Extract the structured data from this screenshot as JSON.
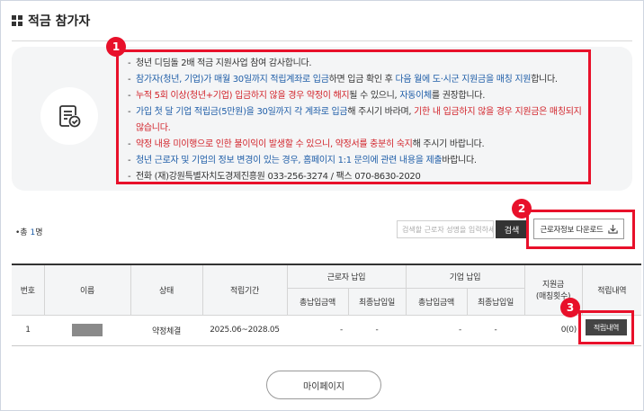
{
  "page": {
    "title": "적금 참가자"
  },
  "notice": {
    "lines": [
      {
        "parts": [
          {
            "t": "청년 디딤돌 2배 적금 지원사업 참여 감사합니다.",
            "c": ""
          }
        ]
      },
      {
        "parts": [
          {
            "t": "참가자(청년, 기업)가 매월 30일까지 적립계좌로 입금",
            "c": "blue"
          },
          {
            "t": "하면 입금 확인 후 ",
            "c": ""
          },
          {
            "t": "다음 월에 도·시군 지원금을 매칭 지원",
            "c": "blue"
          },
          {
            "t": "합니다.",
            "c": ""
          }
        ]
      },
      {
        "parts": [
          {
            "t": "누적 5회 이상(청년+기업) 입금하지 않을 경우 약정이 해지",
            "c": "red"
          },
          {
            "t": "될 수 있으니, ",
            "c": ""
          },
          {
            "t": "자동이체",
            "c": "blue"
          },
          {
            "t": "를 권장합니다.",
            "c": ""
          }
        ]
      },
      {
        "parts": [
          {
            "t": "가입 첫 달 기업 적립금(5만원)을 30일까지 각 계좌로 입금",
            "c": "blue"
          },
          {
            "t": "해 주시기 바라며, ",
            "c": ""
          },
          {
            "t": "기한 내 입금하지 않을 경우 지원금은 매칭되지",
            "c": "red"
          }
        ]
      },
      {
        "parts": [
          {
            "t": "않습니다.",
            "c": "red"
          }
        ],
        "cont": true
      },
      {
        "parts": [
          {
            "t": "약정 내용 미이행으로 인한 불이익이 발생할 수 있으니, 약정서를 충분히 숙지",
            "c": "red"
          },
          {
            "t": "해 주시기 바랍니다.",
            "c": ""
          }
        ]
      },
      {
        "parts": [
          {
            "t": "청년 근로자 및 기업의 정보 변경이 있는 경우, 홈페이지 1:1 문의에 관련 내용을 제출",
            "c": "blue"
          },
          {
            "t": "바랍니다.",
            "c": ""
          }
        ]
      },
      {
        "parts": [
          {
            "t": "전화 (재)강원특별자치도경제진흥원 033-256-3274 / 팩스 070-8630-2020",
            "c": ""
          }
        ]
      }
    ]
  },
  "badges": {
    "b1": "1",
    "b2": "2",
    "b3": "3"
  },
  "toolbar": {
    "total_prefix": "•총 ",
    "total_count": "1",
    "total_suffix": "명",
    "search_placeholder": "검색할 근로자 성명을 입력하세요",
    "search_label": "검색",
    "download_label": "근로자정보 다운로드"
  },
  "table": {
    "headers": {
      "no": "번호",
      "name": "이름",
      "status": "상태",
      "period": "적립기간",
      "worker_group": "근로자 납입",
      "company_group": "기업 납입",
      "subsidy": "지원금",
      "subsidy_sub": "(매칭횟수)",
      "detail": "적립내역",
      "worker_total": "총납입금액",
      "worker_last": "최종납입일",
      "company_total": "총납입금액",
      "company_last": "최종납입일"
    },
    "rows": [
      {
        "no": "1",
        "status": "약정체결",
        "period": "2025.06~2028.05",
        "worker_total": "-",
        "worker_last": "-",
        "company_total": "-",
        "company_last": "-",
        "subsidy": "0(0)",
        "detail_label": "적립내역"
      }
    ]
  },
  "footer": {
    "mypage_label": "마이페이지"
  },
  "colors": {
    "highlight": "#e8102a",
    "blue_text": "#1f5ea8",
    "red_text": "#d2232a"
  }
}
